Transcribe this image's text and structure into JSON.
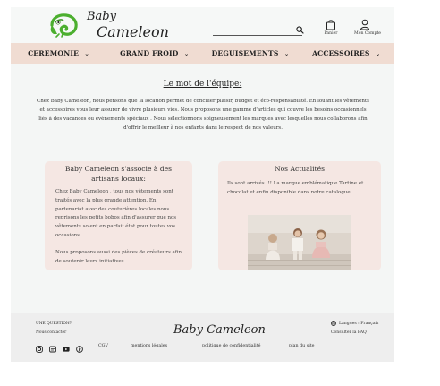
{
  "header": {
    "logo_line1": "Baby",
    "logo_line2": "Cameleon",
    "search_placeholder": "",
    "cart_label": "Panier",
    "account_label": "Mon Compte",
    "icons": [
      "chameleon-logo",
      "search-icon",
      "bag-icon",
      "user-icon"
    ]
  },
  "nav": {
    "items": [
      {
        "label": "CEREMONIE"
      },
      {
        "label": "GRAND FROID"
      },
      {
        "label": "DEGUISEMENTS"
      },
      {
        "label": "ACCESSOIRES"
      }
    ],
    "chevron": "⌄"
  },
  "intro": {
    "title": "Le mot de l'équipe:",
    "text": "Chez Baby Cameleon, nous pensons que la location permet de concilier plaisir, budget et éco-responsabilité. En louant les vêtements et accessoires vous leur assurer de vivre plusieurs vies. Nous proposons une gamme d'articles qui couvre les besoins occasionnels liés à des vacances ou évènements spéciaux . Nous sélectionnons soigneusement les marques avec lesquelles nous collaborons afin d'offrir le meilleur à nos enfants dans le respect de nos valeurs."
  },
  "cards": {
    "artisans": {
      "title": "Baby Cameleon s'associe à des artisans locaux:",
      "p1": "Chez Baby Cameleon , tous nos vêtements sont traités avec la plus grande attention. En partenariat avec des couturières locales nous reprisons les petits bobos afin d'assurer que nos vêtements soient en parfait état pour toutes vos occasions",
      "p2": "Nous proposons aussi des pièces de créateurs afin de soutenir leurs initiatives"
    },
    "news": {
      "title": "Nos Actualités",
      "text": "Ils sont arrivés !!! La marque emblématique Tartine et chocolat et enfin disponible dans notre catalogue"
    }
  },
  "footer": {
    "question": "UNE QUESTION?",
    "contact": "Nous contacter",
    "logo": "Baby Cameleon",
    "language": "Langues : Français",
    "faq": "Consulter la FAQ",
    "links": [
      "CGV",
      "mentions légales",
      "politique de confidentialité",
      "plan du site"
    ],
    "social_icons": [
      "instagram-icon",
      "message-icon",
      "youtube-icon",
      "pinterest-icon"
    ]
  },
  "colors": {
    "nav_bg": "#f0dcd2",
    "card_bg": "#f5e7e3",
    "logo_green": "#4caf2f"
  }
}
